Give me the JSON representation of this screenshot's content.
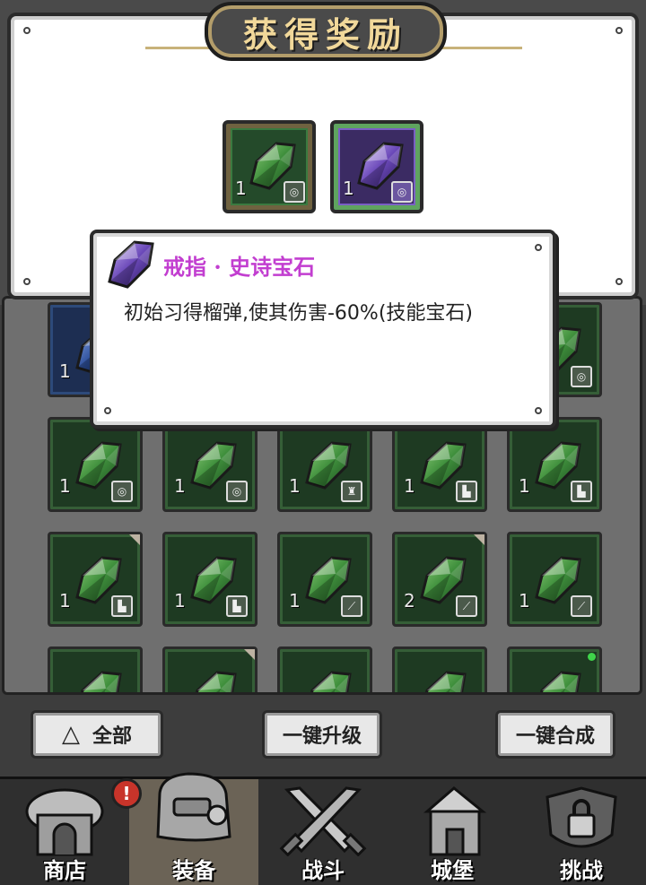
{
  "reward_title": "获得奖励",
  "rewards": [
    {
      "quantity": "1",
      "rarity": "green",
      "slot_icon": "ring-icon"
    },
    {
      "quantity": "1",
      "rarity": "purple",
      "slot_icon": "ring-icon"
    }
  ],
  "tooltip": {
    "title": "戒指 · 史诗宝石",
    "description": "初始习得榴弹,使其伤害-60%(技能宝石)"
  },
  "inventory": [
    {
      "quantity": "1",
      "rarity": "blue",
      "slot_icon": ""
    },
    {
      "quantity": "",
      "rarity": "green",
      "slot_icon": "ring-icon"
    },
    {
      "quantity": "1",
      "rarity": "green",
      "slot_icon": "ring-icon"
    },
    {
      "quantity": "1",
      "rarity": "green",
      "slot_icon": "ring-icon"
    },
    {
      "quantity": "1",
      "rarity": "green",
      "slot_icon": "armor-icon"
    },
    {
      "quantity": "1",
      "rarity": "green",
      "slot_icon": "boot-icon"
    },
    {
      "quantity": "1",
      "rarity": "green",
      "slot_icon": "boot-icon"
    },
    {
      "quantity": "1",
      "rarity": "green",
      "slot_icon": "boot-icon"
    },
    {
      "quantity": "1",
      "rarity": "green",
      "slot_icon": "boot-icon"
    },
    {
      "quantity": "1",
      "rarity": "green",
      "slot_icon": "weapon-icon"
    },
    {
      "quantity": "2",
      "rarity": "green",
      "slot_icon": "weapon-icon"
    },
    {
      "quantity": "1",
      "rarity": "green",
      "slot_icon": "weapon-icon"
    }
  ],
  "buttons": {
    "filter_all": "全部",
    "upgrade_all": "一键升级",
    "merge_all": "一键合成"
  },
  "nav": {
    "shop": "商店",
    "equipment": "装备",
    "battle": "战斗",
    "castle": "城堡",
    "challenge": "挑战",
    "shop_alert": "!",
    "active": "equipment"
  },
  "colors": {
    "epic_title": "#c23ed0",
    "green_gem": "#3f8f3c",
    "purple_gem": "#6a48b8",
    "blue_gem": "#2d4f9a"
  }
}
